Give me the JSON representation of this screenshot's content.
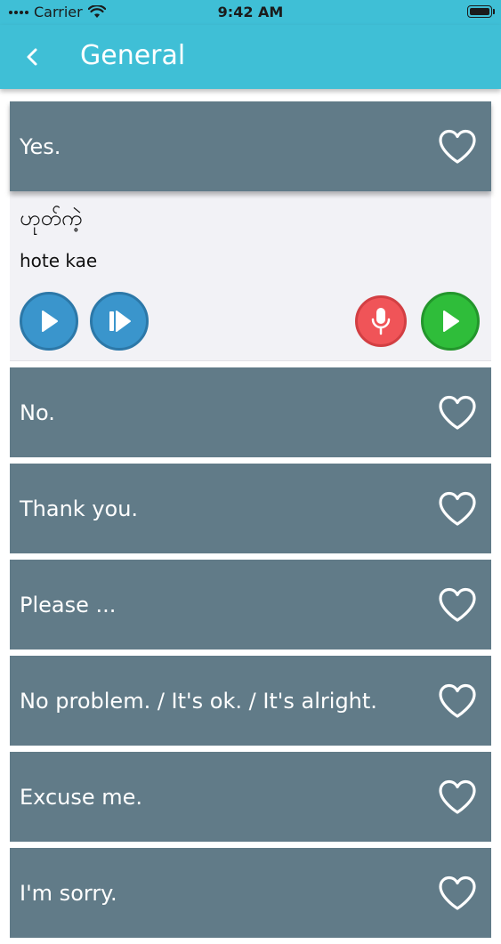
{
  "status_bar": {
    "carrier": "Carrier",
    "time": "9:42 AM"
  },
  "header": {
    "title": "General"
  },
  "expanded": {
    "phrase": "Yes.",
    "native": "ဟုတ်ကဲ့",
    "romanization": "hote kae"
  },
  "phrases": [
    {
      "text": "No."
    },
    {
      "text": "Thank you."
    },
    {
      "text": "Please ..."
    },
    {
      "text": "No problem. / It's ok. / It's alright."
    },
    {
      "text": "Excuse me."
    },
    {
      "text": "I'm sorry."
    }
  ],
  "colors": {
    "header_bg": "#3fbfd6",
    "row_bg": "#617b88",
    "detail_bg": "#f2f2f6",
    "play_blue": "#3a95cc",
    "record_red": "#f05458",
    "playback_green": "#2fbd3a"
  },
  "icons": {
    "back": "chevron-left-icon",
    "favorite": "heart-outline-icon",
    "play": "play-icon",
    "slow_play": "step-play-icon",
    "record": "microphone-icon",
    "playback": "play-icon"
  }
}
